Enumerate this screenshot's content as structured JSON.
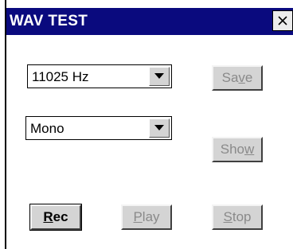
{
  "window": {
    "title": "WAV TEST"
  },
  "sample_rate": {
    "selected": "11025 Hz"
  },
  "channels": {
    "selected": "Mono"
  },
  "buttons": {
    "save": {
      "pre": "Sa",
      "mnemonic": "v",
      "post": "e",
      "enabled": false
    },
    "show": {
      "pre": "Sho",
      "mnemonic": "w",
      "post": "",
      "enabled": false
    },
    "rec": {
      "pre": "",
      "mnemonic": "R",
      "post": "ec",
      "enabled": true
    },
    "play": {
      "pre": "",
      "mnemonic": "P",
      "post": "lay",
      "enabled": false
    },
    "stop": {
      "pre": "",
      "mnemonic": "S",
      "post": "top",
      "enabled": false
    }
  },
  "colors": {
    "titlebar": "#0a0a7e",
    "button_face": "#d4d4d4",
    "disabled_text": "#8a8a8a"
  }
}
